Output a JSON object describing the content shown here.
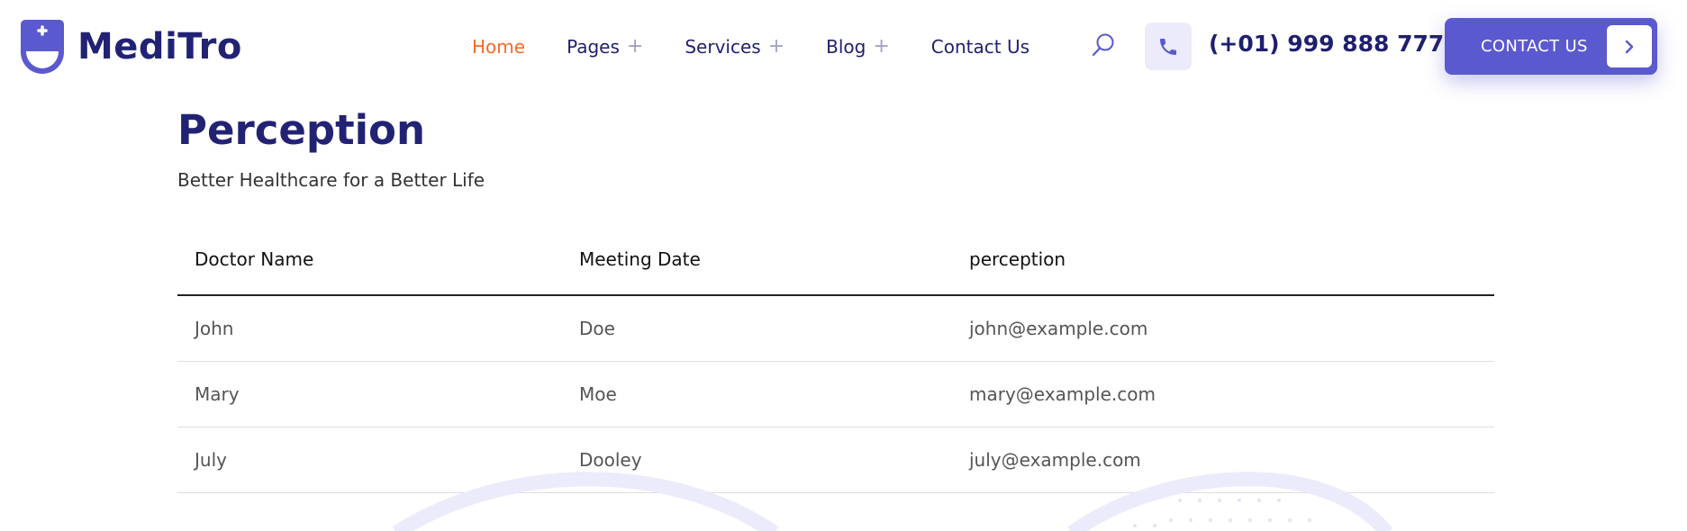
{
  "brand": {
    "name": "MediTro"
  },
  "nav": {
    "items": [
      {
        "label": "Home",
        "active": true,
        "has_submenu": false
      },
      {
        "label": "Pages",
        "active": false,
        "has_submenu": true
      },
      {
        "label": "Services",
        "active": false,
        "has_submenu": true
      },
      {
        "label": "Blog",
        "active": false,
        "has_submenu": true
      },
      {
        "label": "Contact Us",
        "active": false,
        "has_submenu": false
      }
    ],
    "submenu_icon": "+"
  },
  "header": {
    "search_icon": "search-icon",
    "phone_icon": "phone-icon",
    "phone_number": "(+01) 999 888 777",
    "contact_button_label": "CONTACT US",
    "contact_button_icon": "chevron-right-icon"
  },
  "main": {
    "title": "Perception",
    "subtitle": "Better Healthcare for a Better Life"
  },
  "table": {
    "headers": [
      "Doctor Name",
      "Meeting Date",
      "perception"
    ],
    "rows": [
      [
        "John",
        "Doe",
        "john@example.com"
      ],
      [
        "Mary",
        "Moe",
        "mary@example.com"
      ],
      [
        "July",
        "Dooley",
        "july@example.com"
      ]
    ]
  },
  "colors": {
    "brand_navy": "#222275",
    "accent_orange": "#f26c2a",
    "button_purple": "#5a59cf",
    "decor_lavender": "#ebebfb"
  }
}
